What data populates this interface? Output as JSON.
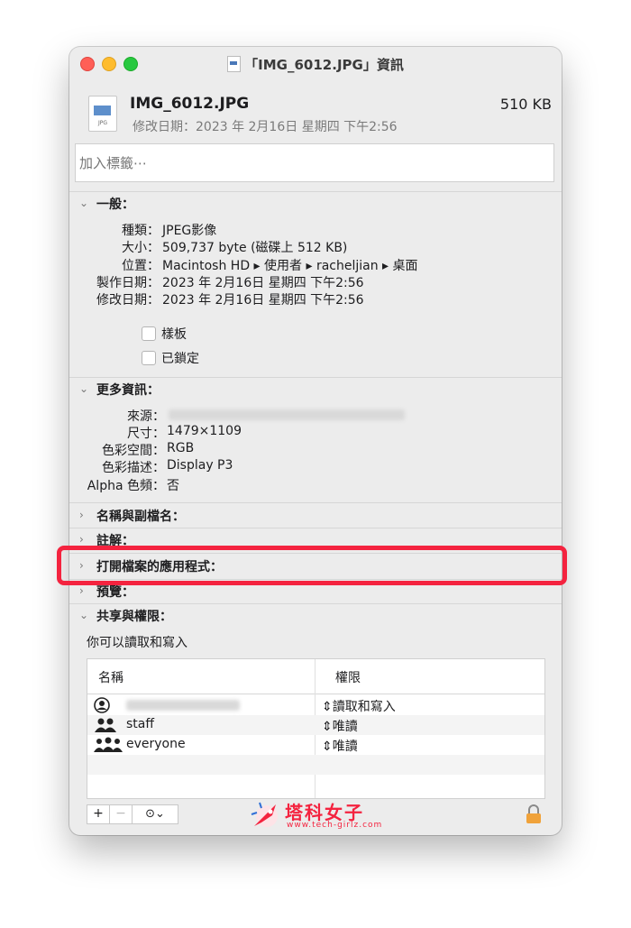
{
  "window": {
    "title": "「IMG_6012.JPG」資訊"
  },
  "file": {
    "name": "IMG_6012.JPG",
    "size": "510 KB",
    "modified": "修改日期：2023 年 2月16日 星期四 下午2:56",
    "icon_label": "JPG"
  },
  "tags": {
    "placeholder": "加入標籤⋯"
  },
  "general": {
    "title": "一般：",
    "rows": [
      {
        "key": "種類：",
        "value": "JPEG影像"
      },
      {
        "key": "大小：",
        "value": "509,737 byte (磁碟上 512 KB)"
      },
      {
        "key": "位置：",
        "value": "Macintosh HD ▸ 使用者 ▸ racheljian ▸ 桌面"
      },
      {
        "key": "製作日期：",
        "value": "2023 年 2月16日 星期四 下午2:56"
      },
      {
        "key": "修改日期：",
        "value": "2023 年 2月16日 星期四 下午2:56"
      }
    ],
    "stationery_label": "樣板",
    "locked_label": "已鎖定"
  },
  "more_info": {
    "title": "更多資訊：",
    "rows": [
      {
        "key": "來源：",
        "value": ""
      },
      {
        "key": "尺寸：",
        "value": "1479×1109"
      },
      {
        "key": "色彩空間：",
        "value": "RGB"
      },
      {
        "key": "色彩描述：",
        "value": "Display P3"
      },
      {
        "key": "Alpha 色頻：",
        "value": "否"
      }
    ]
  },
  "sections": {
    "name_ext": "名稱與副檔名：",
    "comments": "註解：",
    "open_with": "打開檔案的應用程式：",
    "preview": "預覽：",
    "sharing": "共享與權限："
  },
  "sharing": {
    "summary": "你可以讀取和寫入",
    "col_name": "名稱",
    "col_perm": "權限",
    "rows": [
      {
        "name": "",
        "perm": "讀取和寫入",
        "icon": "person-circle-icon"
      },
      {
        "name": "staff",
        "perm": "唯讀",
        "icon": "group-icon"
      },
      {
        "name": "everyone",
        "perm": "唯讀",
        "icon": "everyone-icon"
      }
    ],
    "add": "+",
    "remove": "−",
    "action": "⊙⌄"
  },
  "watermark": {
    "title": "塔科女子",
    "url": "www.tech-girlz.com"
  },
  "colors": {
    "highlight": "#f4233f",
    "window_bg": "#ececec"
  }
}
